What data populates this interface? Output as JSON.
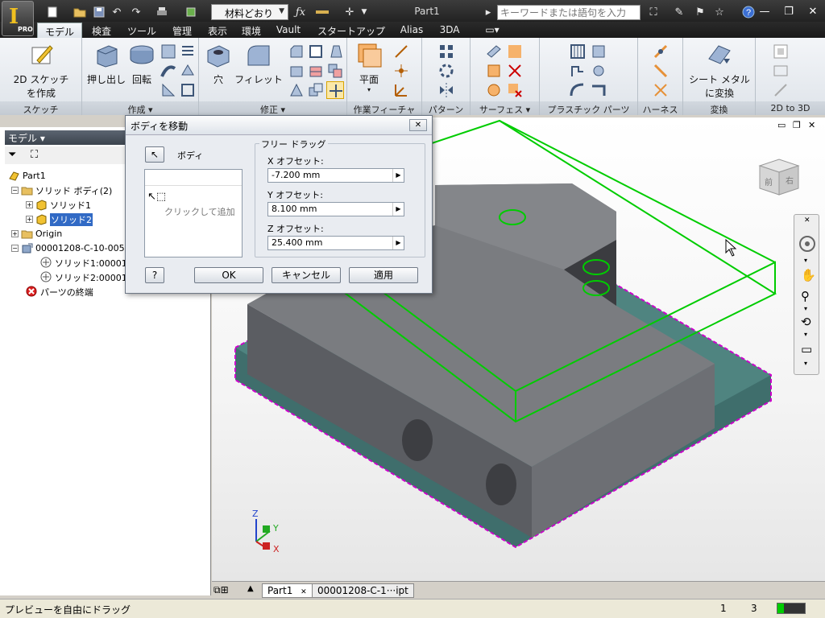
{
  "app": {
    "pro_badge": "PRO"
  },
  "titlebar": {
    "material": "材料どおり",
    "doc_title": "Part1",
    "search_placeholder": "キーワードまたは語句を入力"
  },
  "ribbon_tabs": [
    "モデル",
    "検査",
    "ツール",
    "管理",
    "表示",
    "環境",
    "Vault",
    "スタートアップ",
    "Alias",
    "3DA"
  ],
  "ribbon": {
    "sketch_btn_l1": "2D スケッチ",
    "sketch_btn_l2": "を作成",
    "extrude": "押し出し",
    "revolve": "回転",
    "hole": "穴",
    "fillet": "フィレット",
    "plane": "平面",
    "sheet_metal_l1": "シート メタル",
    "sheet_metal_l2": "に変換",
    "panels": {
      "sketch": "スケッチ",
      "create": "作成 ▾",
      "modify": "修正 ▾",
      "work": "作業フィーチャ",
      "pattern": "パターン",
      "surface": "サーフェス ▾",
      "plastic": "プラスチック パーツ",
      "harness": "ハーネス",
      "convert": "変換",
      "twod": "2D to 3D"
    }
  },
  "browser": {
    "header": "モデル ▾",
    "tree": {
      "part": "Part1",
      "solid_bodies": "ソリッド ボディ(2)",
      "solid1": "ソリッド1",
      "solid2": "ソリッド2",
      "origin": "Origin",
      "derived": "00001208-C-10-005",
      "derived1": "ソリッド1:0000120",
      "derived2": "ソリッド2:0000120",
      "end": "パーツの終端"
    }
  },
  "dialog": {
    "title": "ボディを移動",
    "body_label": "ボディ",
    "click_to_add": "クリックして追加",
    "free_drag": "フリー ドラッグ",
    "x_label": "X オフセット:",
    "x_value": "-7.200 mm",
    "y_label": "Y オフセット:",
    "y_value": "8.100 mm",
    "z_label": "Z オフセット:",
    "z_value": "25.400 mm",
    "ok": "OK",
    "cancel": "キャンセル",
    "apply": "適用",
    "help": "?"
  },
  "viewcube": {
    "front": "前",
    "right": "右"
  },
  "axes": {
    "x": "X",
    "y": "Y",
    "z": "Z"
  },
  "doc_tabs": [
    "Part1",
    "00001208-C-1···ipt"
  ],
  "status": {
    "message": "プレビューを自由にドラッグ",
    "count1": "1",
    "count2": "3"
  },
  "colors": {
    "preview_green": "#00cc00",
    "selection_magenta": "#cc00cc",
    "body_gray": "#7a7c80",
    "base_teal": "#3f6e6c"
  }
}
